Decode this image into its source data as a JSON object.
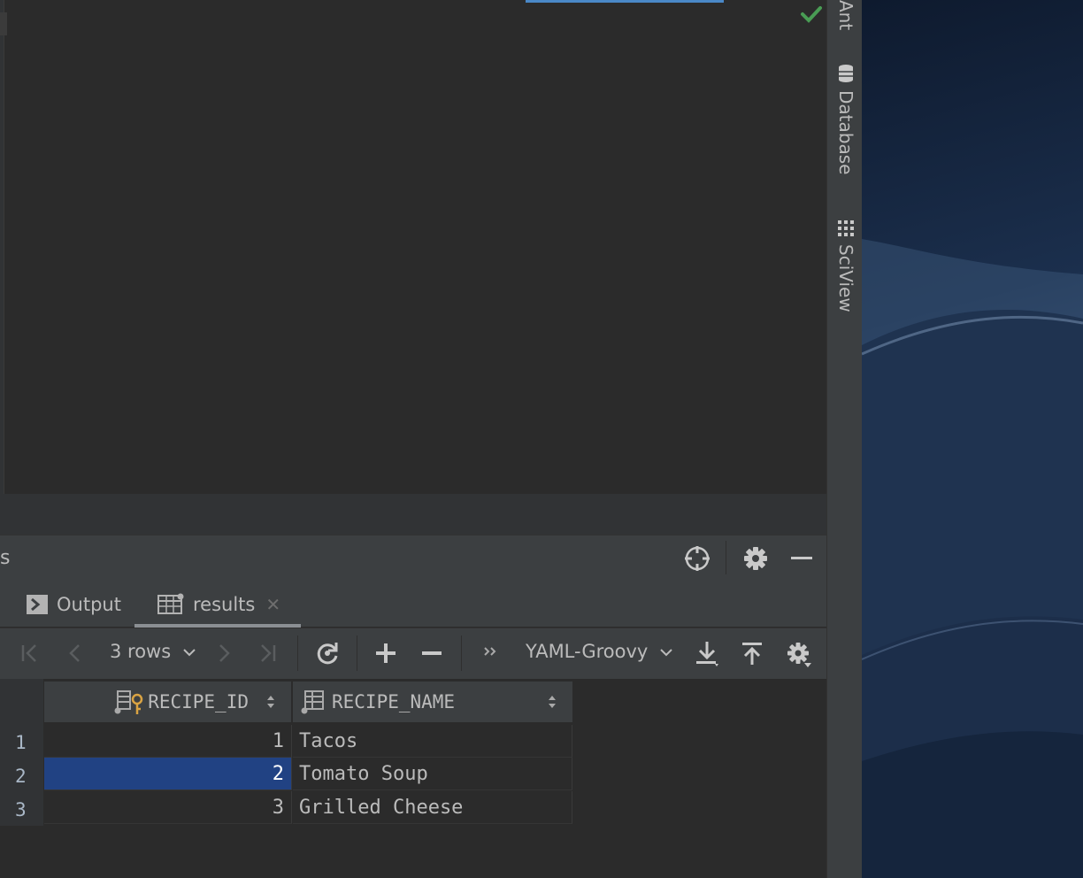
{
  "tool_window": {
    "title": "s",
    "tabs": [
      {
        "label": "Output"
      },
      {
        "label": "results",
        "close": "✕"
      }
    ]
  },
  "toolbar": {
    "rows_label": "3 rows",
    "exporter": "YAML-Groovy"
  },
  "grid": {
    "columns": [
      {
        "name": "RECIPE_ID"
      },
      {
        "name": "RECIPE_NAME"
      }
    ],
    "rows": [
      {
        "num": "1",
        "id": "1",
        "name": "Tacos"
      },
      {
        "num": "2",
        "id": "2",
        "name": "Tomato Soup",
        "selected": true
      },
      {
        "num": "3",
        "id": "3",
        "name": "Grilled Cheese"
      }
    ]
  },
  "sidebar": {
    "items": [
      {
        "label": "Ant"
      },
      {
        "label": "Database"
      },
      {
        "label": "SciView"
      }
    ]
  },
  "colors": {
    "selection": "#214283",
    "accent": "#4a88c7",
    "check": "#499c54",
    "key": "#d9a343"
  }
}
